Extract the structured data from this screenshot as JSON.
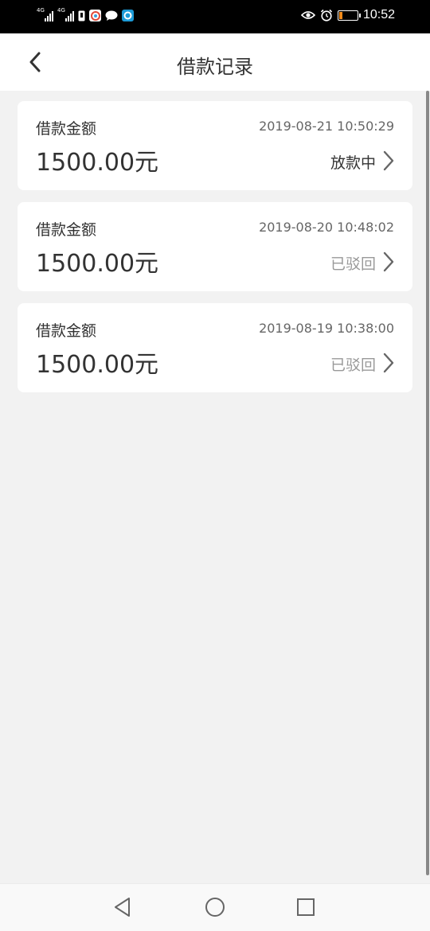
{
  "status_bar": {
    "network_1": "4G",
    "network_2": "4G",
    "time": "10:52",
    "battery_level": 0.2,
    "battery_color": "#f08a1a"
  },
  "header": {
    "title": "借款记录",
    "back_icon": "chevron-left-icon"
  },
  "records": [
    {
      "label": "借款金额",
      "time": "2019-08-21 10:50:29",
      "amount": "1500.00元",
      "status": "放款中",
      "status_muted": false
    },
    {
      "label": "借款金额",
      "time": "2019-08-20 10:48:02",
      "amount": "1500.00元",
      "status": "已驳回",
      "status_muted": true
    },
    {
      "label": "借款金额",
      "time": "2019-08-19 10:38:00",
      "amount": "1500.00元",
      "status": "已驳回",
      "status_muted": true
    }
  ],
  "colors": {
    "background": "#f2f2f2",
    "card": "#ffffff",
    "text_primary": "#333333",
    "text_muted": "#999999"
  },
  "nav_bar": {
    "icons": [
      "triangle-back-icon",
      "circle-home-icon",
      "square-recents-icon"
    ]
  }
}
